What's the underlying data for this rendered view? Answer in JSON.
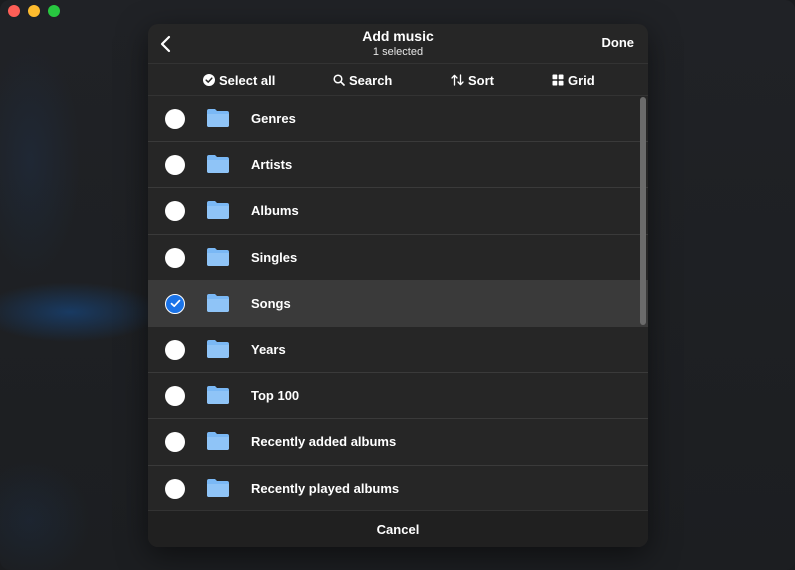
{
  "window": {
    "traffic_lights": [
      "close",
      "minimize",
      "maximize"
    ]
  },
  "sheet": {
    "title": "Add music",
    "subtitle": "1 selected",
    "done_label": "Done",
    "cancel_label": "Cancel"
  },
  "toolbar": {
    "select_all": "Select all",
    "search": "Search",
    "sort": "Sort",
    "grid": "Grid"
  },
  "list": {
    "items": [
      {
        "label": "Genres",
        "checked": false
      },
      {
        "label": "Artists",
        "checked": false
      },
      {
        "label": "Albums",
        "checked": false
      },
      {
        "label": "Singles",
        "checked": false
      },
      {
        "label": "Songs",
        "checked": true
      },
      {
        "label": "Years",
        "checked": false
      },
      {
        "label": "Top 100",
        "checked": false
      },
      {
        "label": "Recently added albums",
        "checked": false
      },
      {
        "label": "Recently played albums",
        "checked": false
      }
    ]
  },
  "colors": {
    "accent": "#1a73e8",
    "folder": "#7ab8f5"
  }
}
